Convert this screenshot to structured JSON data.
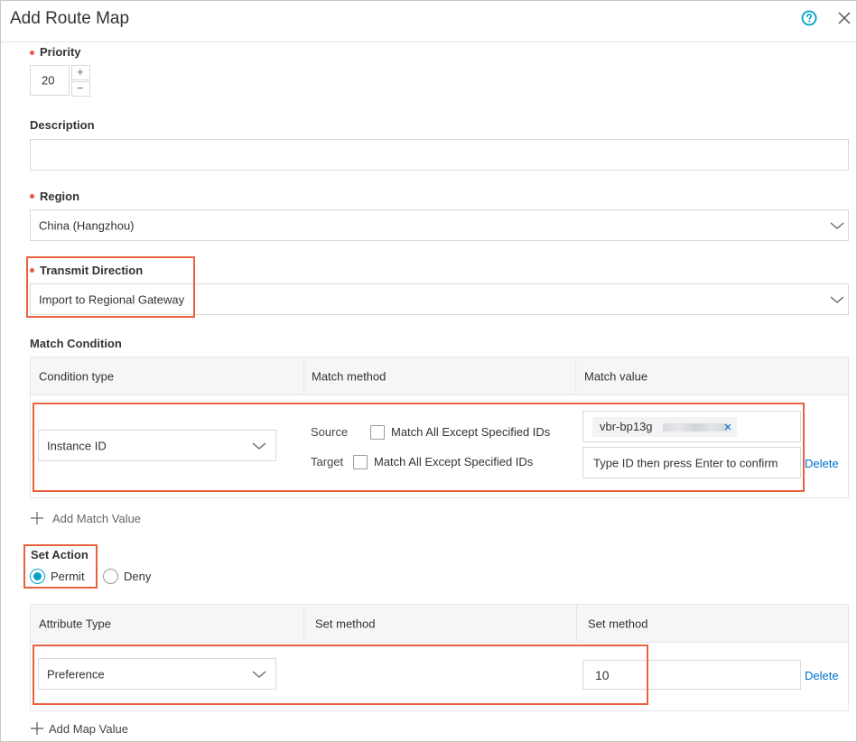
{
  "dialog": {
    "title": "Add Route Map"
  },
  "priority": {
    "label": "Priority",
    "value": "20",
    "increment_symbol": "+",
    "decrement_symbol": "−"
  },
  "description": {
    "label": "Description",
    "value": ""
  },
  "region": {
    "label": "Region",
    "value": "China (Hangzhou)"
  },
  "transmit_direction": {
    "label": "Transmit Direction",
    "value": "Import to Regional Gateway"
  },
  "match_condition": {
    "label": "Match Condition",
    "columns": [
      "Condition type",
      "Match method",
      "Match value"
    ],
    "row": {
      "condition_type": "Instance ID",
      "source_label": "Source",
      "source_option": "Match All Except Specified IDs",
      "target_label": "Target",
      "target_option": "Match All Except Specified IDs",
      "source_tag": "vbr-bp13g",
      "target_placeholder": "Type ID then press Enter to confirm",
      "delete_label": "Delete"
    },
    "add_label": "Add Match Value"
  },
  "set_action": {
    "label": "Set Action",
    "options": [
      "Permit",
      "Deny"
    ],
    "selected": "Permit"
  },
  "map_table": {
    "columns": [
      "Attribute Type",
      "Set method",
      "Set method"
    ],
    "row": {
      "attribute_type": "Preference",
      "value": "10",
      "delete_label": "Delete"
    },
    "add_label": "Add Map Value"
  },
  "colors": {
    "accent": "#00a2ca",
    "required_dot": "#e8574b",
    "highlight": "#e8613f",
    "link": "#0070cc"
  },
  "icons": [
    "help-icon",
    "close-icon",
    "chevron-down-icon",
    "plus-icon",
    "tag-remove-icon"
  ]
}
